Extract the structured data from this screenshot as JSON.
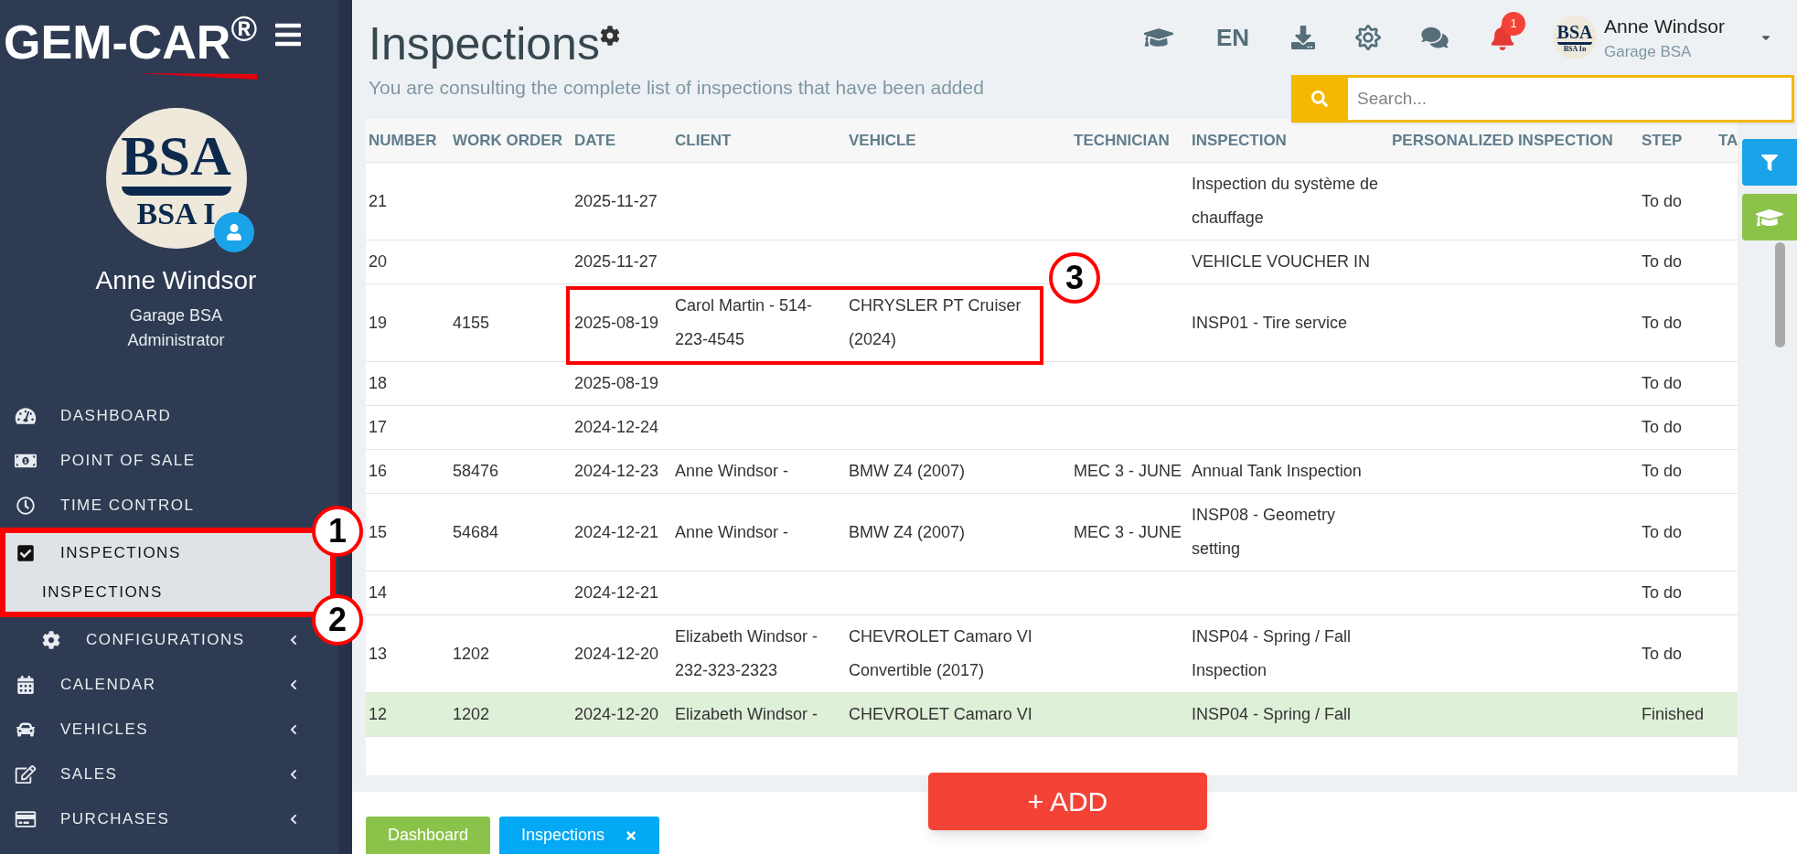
{
  "sidebar": {
    "logo": "GEM-CAR$^{®}$",
    "avatar": {
      "logo_text": "BSA",
      "logo_subtext": "BSA I"
    },
    "user_name": "Anne Windsor",
    "company": "Garage BSA",
    "role": "Administrator",
    "menu": [
      {
        "label": "DASHBOARD",
        "selected": false,
        "expandable": false
      },
      {
        "label": "POINT OF SALE",
        "selected": false,
        "expandable": false
      },
      {
        "label": "TIME CONTROL",
        "selected": false,
        "expandable": false
      },
      {
        "label": "INSPECTIONS",
        "selected": true,
        "expandable": false,
        "children": [
          {
            "label": "INSPECTIONS",
            "selected": true,
            "expandable": false
          },
          {
            "label": "CONFIGURATIONS",
            "selected": false,
            "expandable": true
          }
        ]
      },
      {
        "label": "CALENDAR",
        "selected": false,
        "expandable": true
      },
      {
        "label": "VEHICLES",
        "selected": false,
        "expandable": true
      },
      {
        "label": "SALES",
        "selected": false,
        "expandable": true
      },
      {
        "label": "PURCHASES",
        "selected": false,
        "expandable": true
      }
    ]
  },
  "header": {
    "title": "Inspections",
    "subtitle": "You are consulting the complete list of inspections that have been added",
    "language": "EN",
    "notifications": "1",
    "user": {
      "logo_text": "BSA",
      "logo_subtext": "BSA In",
      "name": "Anne Windsor",
      "company": "Garage BSA"
    },
    "search": {
      "placeholder": "Search..."
    }
  },
  "table": {
    "columns": [
      "NUMBER",
      "WORK ORDER",
      "DATE",
      "CLIENT",
      "VEHICLE",
      "TECHNICIAN",
      "INSPECTION",
      "PERSONALIZED INSPECTION",
      "STEP",
      "TA"
    ],
    "rows": [
      {
        "highlighted": false,
        "cells": [
          "21",
          null,
          "2025-11-27",
          null,
          null,
          null,
          "Inspection du système de chauffage",
          null,
          "To do",
          null
        ]
      },
      {
        "highlighted": false,
        "cells": [
          "20",
          null,
          "2025-11-27",
          null,
          null,
          null,
          "VEHICLE VOUCHER IN",
          null,
          "To do",
          null
        ]
      },
      {
        "highlighted": false,
        "cells": [
          "19",
          "4155",
          "2025-08-19",
          "Carol Martin - 514-223-4545",
          "CHRYSLER PT Cruiser (2024)",
          null,
          "INSP01 - Tire service",
          null,
          "To do",
          null
        ]
      },
      {
        "highlighted": false,
        "cells": [
          "18",
          null,
          "2025-08-19",
          null,
          null,
          null,
          null,
          null,
          "To do",
          null
        ]
      },
      {
        "highlighted": false,
        "cells": [
          "17",
          null,
          "2024-12-24",
          null,
          null,
          null,
          null,
          null,
          "To do",
          null
        ]
      },
      {
        "highlighted": false,
        "cells": [
          "16",
          "58476",
          "2024-12-23",
          "Anne Windsor -",
          "BMW Z4 (2007)",
          "MEC 3 - JUNE",
          "Annual Tank Inspection",
          null,
          "To do",
          null
        ]
      },
      {
        "highlighted": false,
        "cells": [
          "15",
          "54684",
          "2024-12-21",
          "Anne Windsor -",
          "BMW Z4 (2007)",
          "MEC 3 - JUNE",
          "INSP08 - Geometry setting",
          null,
          "To do",
          null
        ]
      },
      {
        "highlighted": false,
        "cells": [
          "14",
          null,
          "2024-12-21",
          null,
          null,
          null,
          null,
          null,
          "To do",
          null
        ]
      },
      {
        "highlighted": false,
        "cells": [
          "13",
          "1202",
          "2024-12-20",
          "Elizabeth Windsor - 232-323-2323",
          "CHEVROLET Camaro VI Convertible (2017)",
          null,
          "INSP04 - Spring / Fall Inspection",
          null,
          "To do",
          null
        ]
      },
      {
        "highlighted": true,
        "cells": [
          "12",
          "1202",
          "2024-12-20",
          "Elizabeth Windsor -",
          "CHEVROLET Camaro VI",
          null,
          "INSP04 - Spring / Fall",
          null,
          "Finished",
          null
        ]
      }
    ]
  },
  "add_button": "+ ADD",
  "tabs": [
    {
      "label": "Dashboard",
      "selected": false,
      "closable": false
    },
    {
      "label": "Inspections",
      "selected": true,
      "closable": true
    }
  ],
  "annotations": [
    {
      "label": "1"
    },
    {
      "label": "2"
    },
    {
      "label": "3"
    }
  ]
}
